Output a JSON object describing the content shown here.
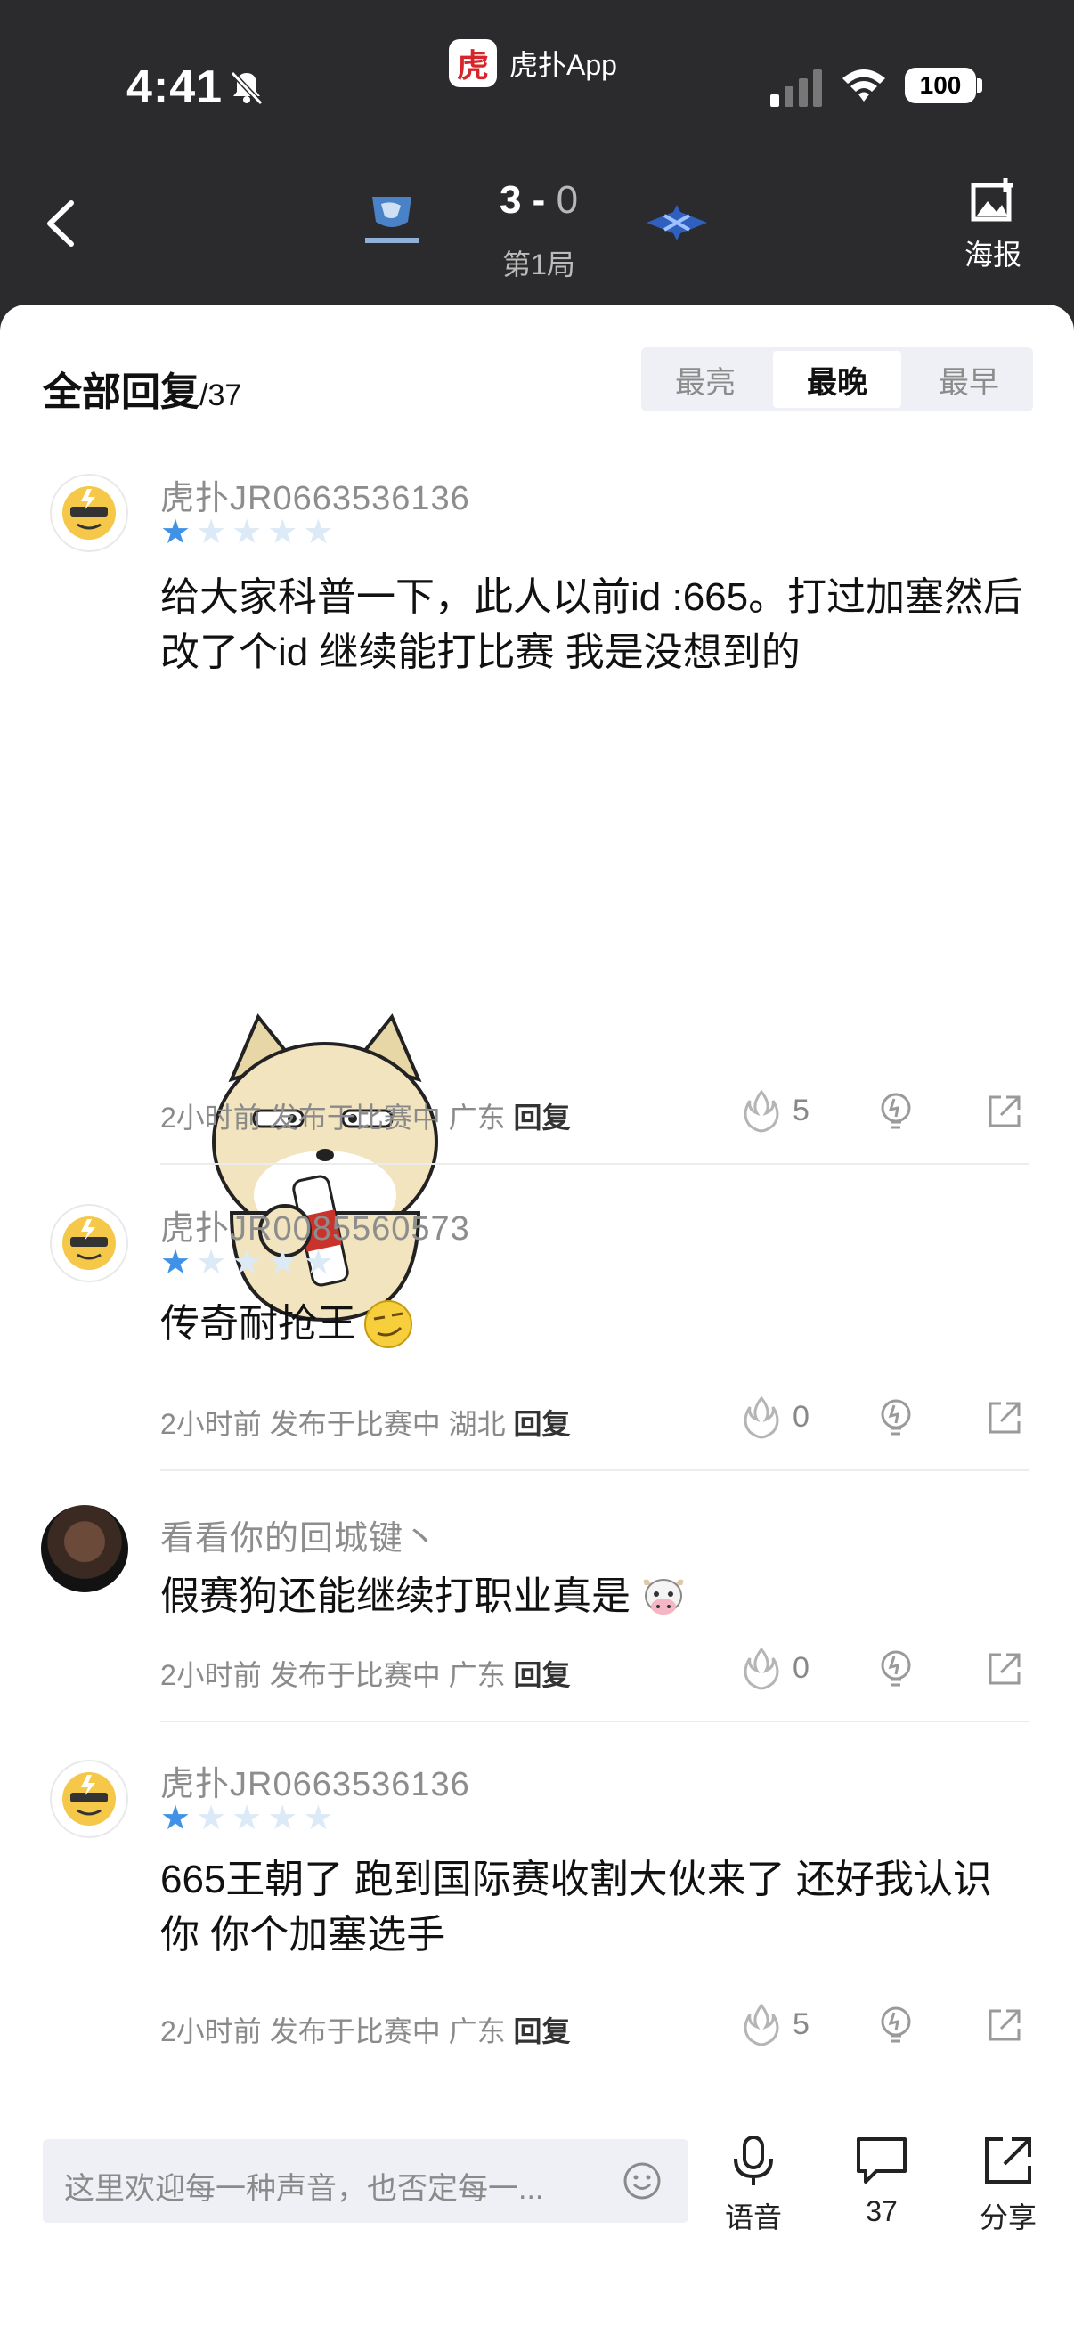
{
  "status": {
    "time": "4:41",
    "battery": "100"
  },
  "app_banner": {
    "logo_text": "虎",
    "name": "虎扑App"
  },
  "match": {
    "score_left": "3",
    "score_sep": "-",
    "score_right": "0",
    "game": "第1局"
  },
  "poster": {
    "label": "海报"
  },
  "replies": {
    "title": "全部回复",
    "count": "/37"
  },
  "sort_tabs": [
    "最亮",
    "最晚",
    "最早"
  ],
  "sort_active": "最晚",
  "comments": [
    {
      "user": "虎扑JR0663536136",
      "stars": 1,
      "text": "给大家科普一下，此人以前id :665。打过加塞然后改了个id 继续能打比赛 我是没想到的",
      "meta": "2小时前 发布于比赛中 广东",
      "reply": "回复",
      "lights": "5"
    },
    {
      "user": "虎扑JR0085560573",
      "stars": 1,
      "text": "传奇耐抢王",
      "meta": "2小时前 发布于比赛中 湖北",
      "reply": "回复",
      "lights": "0"
    },
    {
      "user": "看看你的回城键丶",
      "text": "假赛狗还能继续打职业真是",
      "meta": "2小时前 发布于比赛中 广东",
      "reply": "回复",
      "lights": "0"
    },
    {
      "user": "虎扑JR0663536136",
      "stars": 1,
      "text": "665王朝了 跑到国际赛收割大伙来了 还好我认识你 你个加塞选手",
      "meta": "2小时前 发布于比赛中 广东",
      "reply": "回复",
      "lights": "5"
    }
  ],
  "bottom": {
    "placeholder": "这里欢迎每一种声音，也否定每一...",
    "voice": "语音",
    "comments": "37",
    "share": "分享"
  },
  "colors": {
    "header_bg": "#2b2b2d",
    "star": "#3f92e6",
    "accent_red": "#d6262b"
  }
}
